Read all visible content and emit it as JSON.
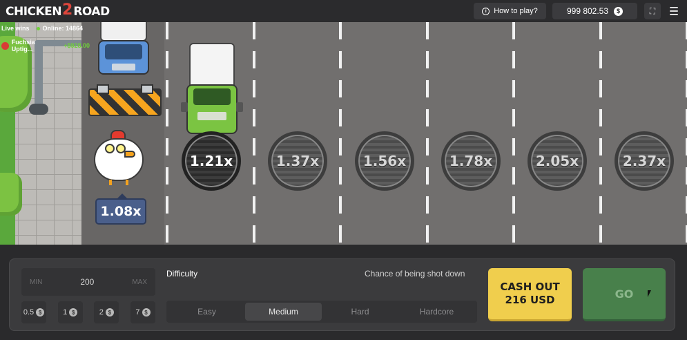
{
  "header": {
    "logo_word1": "CHICKEN",
    "logo_number": "2",
    "logo_word2": "ROAD",
    "how_to_play": "How to play?",
    "balance": "999 802.53",
    "currency_symbol": "$"
  },
  "live": {
    "label": "Live wins",
    "online": "Online: 14864",
    "latest_win_player": "Fuchsia Uptig...",
    "latest_win_amount": "+$928.00"
  },
  "game": {
    "current_multiplier": "1.08x",
    "multipliers": [
      "1.21x",
      "1.37x",
      "1.56x",
      "1.78x",
      "2.05x",
      "2.37x"
    ]
  },
  "bet": {
    "min_label": "MIN",
    "value": "200",
    "max_label": "MAX",
    "quick_chips": [
      "0.5",
      "1",
      "2",
      "7"
    ]
  },
  "difficulty": {
    "label": "Difficulty",
    "chance_label": "Chance of being shot down",
    "options": [
      "Easy",
      "Medium",
      "Hard",
      "Hardcore"
    ],
    "selected": "Medium"
  },
  "actions": {
    "cashout_line1": "CASH OUT",
    "cashout_line2": "216 USD",
    "go": "GO"
  },
  "colors": {
    "cashout_bg": "#f0ce4d",
    "go_bg": "#48804b",
    "multiplier_badge": "#4a5f8b",
    "road": "#716f6e"
  }
}
